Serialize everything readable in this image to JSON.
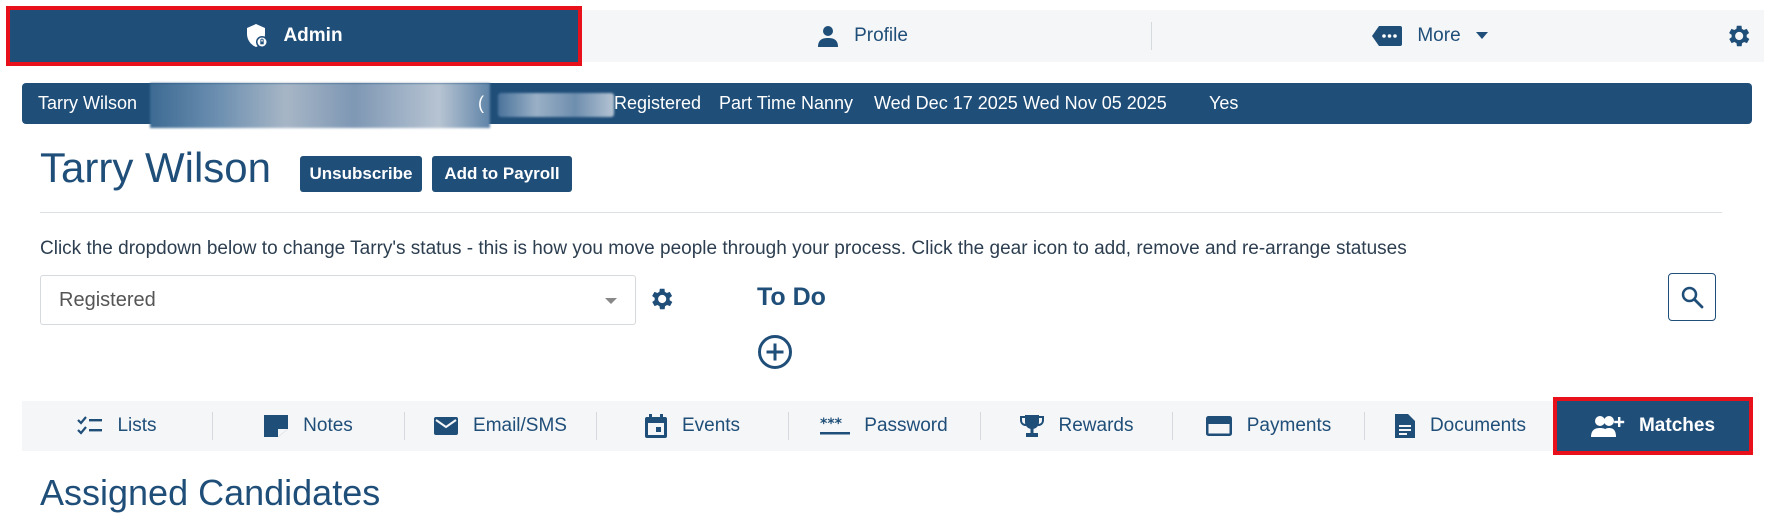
{
  "topnav": {
    "admin_label": "Admin",
    "profile_label": "Profile",
    "more_label": "More"
  },
  "infobar": {
    "name": "Tarry Wilson",
    "paren": "(",
    "status": "Registered",
    "role": "Part Time Nanny",
    "date1": "Wed Dec 17 2025",
    "date2": "Wed Nov 05 2025",
    "flag": "Yes"
  },
  "header": {
    "title": "Tarry Wilson",
    "unsubscribe_label": "Unsubscribe",
    "payroll_label": "Add to Payroll"
  },
  "help_text": "Click the dropdown below to change Tarry's status - this is how you move people through your process. Click the gear icon to add, remove and re-arrange statuses",
  "status_select": {
    "value": "Registered"
  },
  "todo": {
    "title": "To Do"
  },
  "subtabs": [
    {
      "label": "Lists",
      "icon": "checklist-icon"
    },
    {
      "label": "Notes",
      "icon": "note-icon"
    },
    {
      "label": "Email/SMS",
      "icon": "envelope-icon"
    },
    {
      "label": "Events",
      "icon": "calendar-icon"
    },
    {
      "label": "Password",
      "icon": "password-icon"
    },
    {
      "label": "Rewards",
      "icon": "trophy-icon"
    },
    {
      "label": "Payments",
      "icon": "credit-card-icon"
    },
    {
      "label": "Documents",
      "icon": "document-icon"
    },
    {
      "label": "Matches",
      "icon": "add-user-icon"
    }
  ],
  "section": {
    "title": "Assigned Candidates"
  },
  "colors": {
    "primary": "#1f4e79",
    "highlight": "#e8101a",
    "tab_bg": "#f5f6f7"
  }
}
